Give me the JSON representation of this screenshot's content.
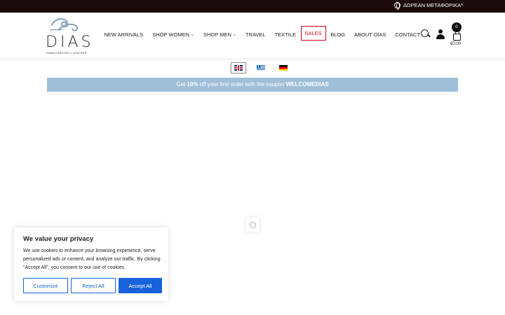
{
  "topbar": {
    "promo_text": "ΔΩΡΕΑΝ ΜΕΤΑΦΟΡΙΚΑ*"
  },
  "logo": {
    "brand": "DIAS",
    "tagline": "HANDCRAFTED | LEATHER"
  },
  "nav": {
    "items": [
      {
        "label": "NEW ARRIVALS",
        "has_dropdown": false
      },
      {
        "label": "SHOP WOMEN",
        "has_dropdown": true
      },
      {
        "label": "SHOP MEN",
        "has_dropdown": true
      },
      {
        "label": "TRAVEL",
        "has_dropdown": false
      },
      {
        "label": "TEXTILE",
        "has_dropdown": false
      },
      {
        "label": "SALES",
        "has_dropdown": false
      },
      {
        "label": "BLOG",
        "has_dropdown": false
      },
      {
        "label": "ABOUT DIAS",
        "has_dropdown": false
      },
      {
        "label": "CONTACT",
        "has_dropdown": false
      }
    ],
    "chevron": "⌄"
  },
  "cart": {
    "count": "0",
    "total": "€0.00"
  },
  "languages": [
    "en",
    "el",
    "de"
  ],
  "coupon": {
    "prefix": "Get ",
    "discount": "10%",
    "middle": " off your first order with the coupon ",
    "code": "WELCOMEDIAS"
  },
  "cookie": {
    "title": "We value your privacy",
    "text": "We use cookies to enhance your browsing experience, serve personalized ads or content, and analyze our traffic. By clicking \"Accept All\", you consent to our use of cookies.",
    "customize_label": "Customize",
    "reject_label": "Reject All",
    "accept_label": "Accept All"
  },
  "colors": {
    "topbar": "#1a0a0a",
    "coupon_bar": "#9fbfd9",
    "sales_border": "#d0021b",
    "cookie_accent": "#1863dc"
  }
}
